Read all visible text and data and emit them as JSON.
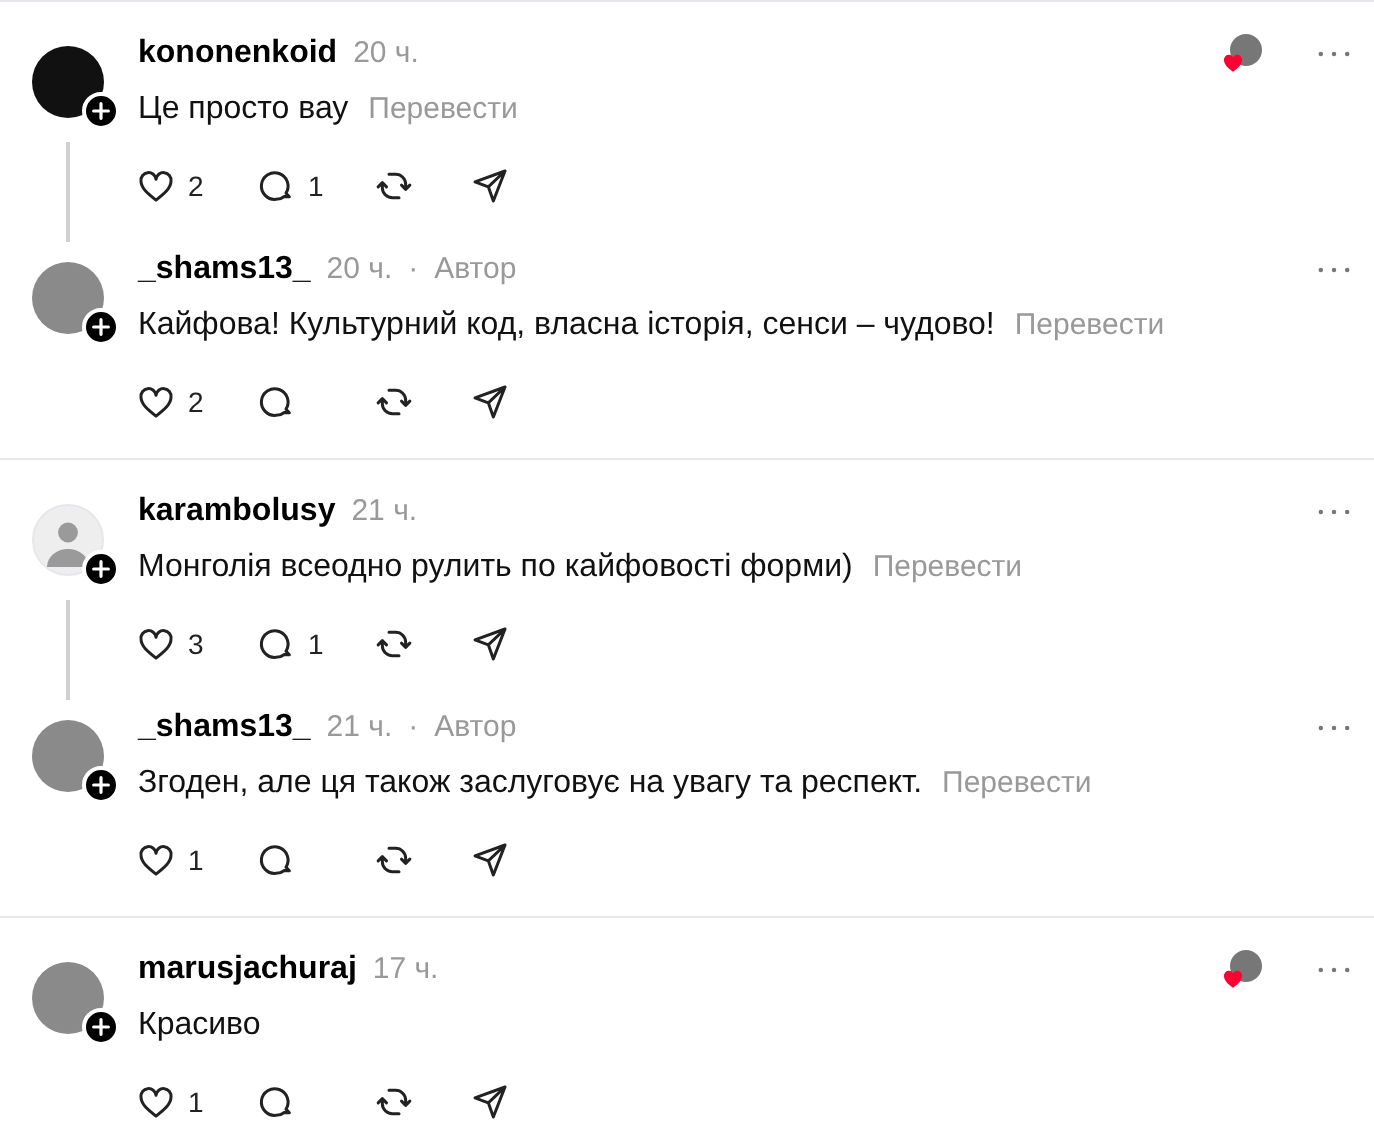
{
  "threads": [
    {
      "posts": [
        {
          "author": "kononenkoid",
          "time": "20 ч.",
          "kind": "logo",
          "liked_by_author": true,
          "text": "Це просто вау",
          "translate": "Перевести",
          "likes": "2",
          "replies": "1"
        },
        {
          "author": "_shams13_",
          "time": "20 ч.",
          "separator": "·",
          "badge": "Автор",
          "kind": "photo",
          "liked_by_author": false,
          "text": "Кайфова! Культурний код, власна історія, сенси – чудово!",
          "translate": "Перевести",
          "likes": "2"
        }
      ]
    },
    {
      "posts": [
        {
          "author": "karambolusy",
          "time": "21 ч.",
          "kind": "default",
          "liked_by_author": false,
          "text": "Монголія всеодно рулить по кайфовості форми)",
          "translate": "Перевести",
          "likes": "3",
          "replies": "1"
        },
        {
          "author": "_shams13_",
          "time": "21 ч.",
          "separator": "·",
          "badge": "Автор",
          "kind": "photo",
          "liked_by_author": false,
          "text": "Згоден, але ця також заслуговує на увагу та респект.",
          "translate": "Перевести",
          "likes": "1"
        }
      ]
    },
    {
      "posts": [
        {
          "author": "marusjachuraj",
          "time": "17 ч.",
          "kind": "photo",
          "liked_by_author": true,
          "text": "Красиво",
          "likes": "1"
        }
      ]
    }
  ]
}
